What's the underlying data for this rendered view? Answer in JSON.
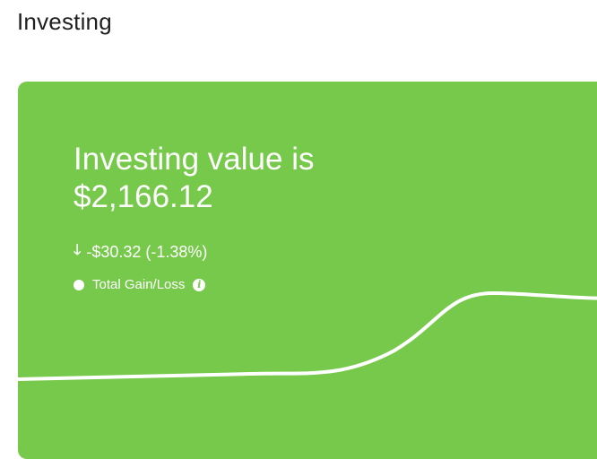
{
  "page": {
    "title": "Investing"
  },
  "card": {
    "background_color": "#76c94a",
    "headline": "Investing value is",
    "value": "$2,166.12",
    "change_icon": "arrow-down-icon",
    "change": "-$30.32 (-1.38%)",
    "legend_label": "Total Gain/Loss",
    "info_icon": "info-icon"
  }
}
